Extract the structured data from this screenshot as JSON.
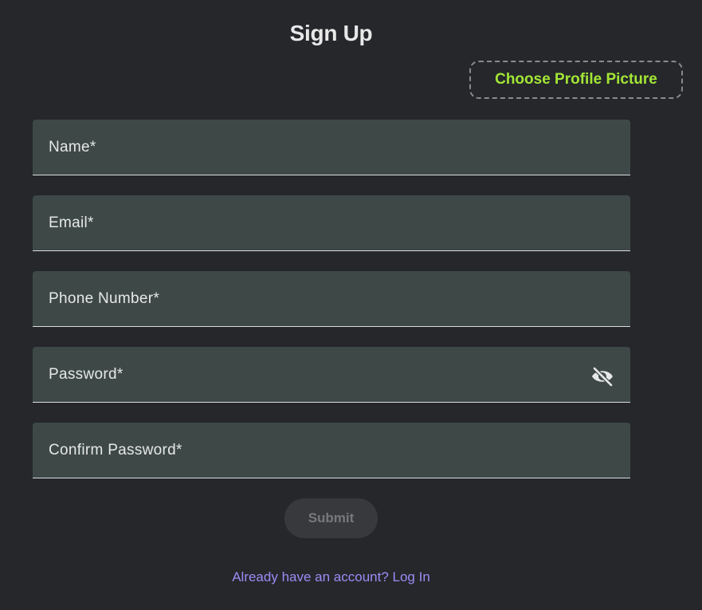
{
  "page": {
    "title": "Sign Up"
  },
  "profile_picture": {
    "label": "Choose Profile Picture"
  },
  "fields": {
    "name": {
      "label": "Name*"
    },
    "email": {
      "label": "Email*"
    },
    "phone": {
      "label": "Phone Number*"
    },
    "password": {
      "label": "Password*",
      "toggle_icon": "eye-off-icon"
    },
    "confirm_password": {
      "label": "Confirm Password*"
    }
  },
  "submit": {
    "label": "Submit",
    "disabled": true
  },
  "login": {
    "text": "Already have an account? Log In"
  },
  "colors": {
    "background": "#25272b",
    "field_background": "#3e4947",
    "accent_green": "#a3e635",
    "link_purple": "#9b8cf5"
  }
}
